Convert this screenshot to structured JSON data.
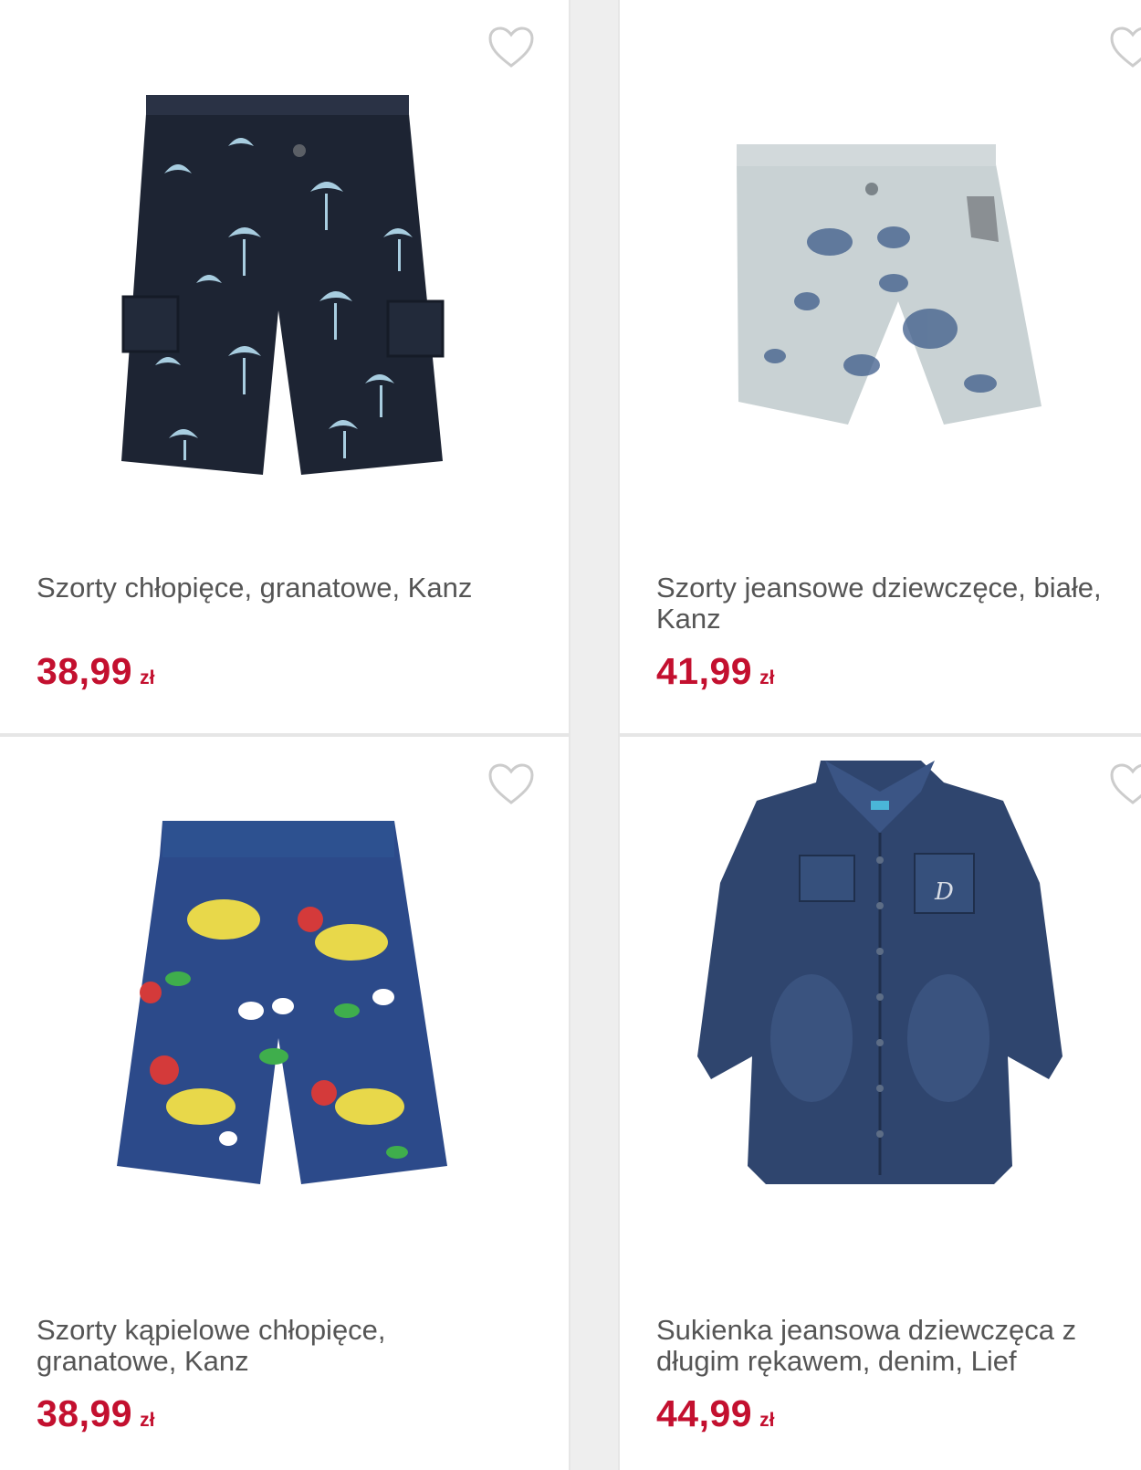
{
  "products": [
    {
      "title": "Szorty chłopięce, granatowe, Kanz",
      "price": "38,99",
      "currency": "zł",
      "image_icon": "palm-print-shorts-image",
      "favorite_icon": "heart-outline-icon"
    },
    {
      "title": "Szorty jeansowe dziewczęce, białe, Kanz",
      "title_line1": "Szorty jeansowe dziewczęce, białe,",
      "title_line2": "Kanz",
      "price": "41,99",
      "currency": "zł",
      "image_icon": "tie-dye-denim-shorts-image",
      "favorite_icon": "heart-outline-icon"
    },
    {
      "title_line1": "Szorty kąpielowe chłopięce,",
      "title_line2": "granatowe, Kanz",
      "price": "38,99",
      "currency": "zł",
      "image_icon": "comic-print-swim-shorts-image",
      "favorite_icon": "heart-outline-icon"
    },
    {
      "title_line1": "Sukienka jeansowa dziewczęca z",
      "title_line2": "długim rękawem, denim, Lief",
      "price": "44,99",
      "currency": "zł",
      "image_icon": "denim-shirt-dress-image",
      "favorite_icon": "heart-outline-icon"
    }
  ],
  "colors": {
    "price": "#c3102f",
    "title": "#555555",
    "divider": "#e6e6e6",
    "heart": "#cccccc"
  }
}
